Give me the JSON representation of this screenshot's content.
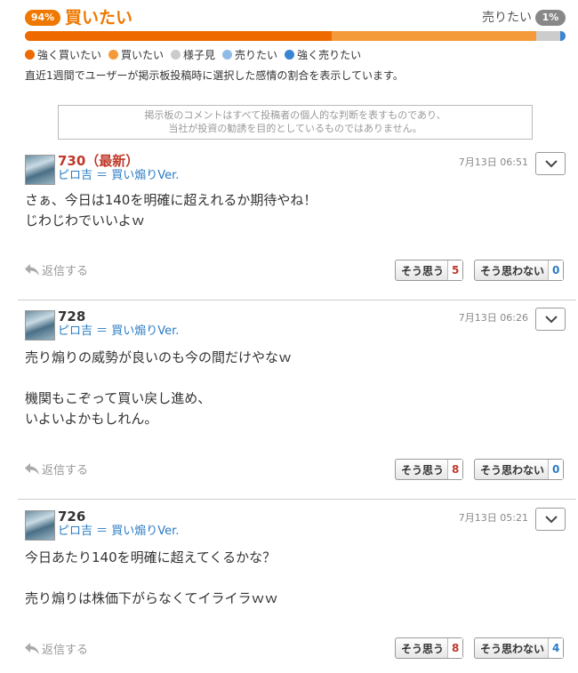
{
  "sentiment": {
    "buy_percent": "94%",
    "buy_label": "買いたい",
    "sell_label": "売りたい",
    "sell_percent": "1%",
    "bar_segments": [
      {
        "name": "strong-buy",
        "fraction": 0.57,
        "color": "#ee6a00"
      },
      {
        "name": "buy",
        "fraction": 0.38,
        "color": "#f59a3a"
      },
      {
        "name": "neutral",
        "fraction": 0.045,
        "color": "#cccccc"
      },
      {
        "name": "sell",
        "fraction": 0.0,
        "color": "#8fbce6"
      },
      {
        "name": "strong-sell",
        "fraction": 0.01,
        "color": "#3a84d4"
      }
    ],
    "legend": [
      {
        "label": "強く買いたい",
        "color": "#ee6a00"
      },
      {
        "label": "買いたい",
        "color": "#f59a3a"
      },
      {
        "label": "様子見",
        "color": "#cccccc"
      },
      {
        "label": "売りたい",
        "color": "#8fbce6"
      },
      {
        "label": "強く売りたい",
        "color": "#3a84d4"
      }
    ],
    "note": "直近1週間でユーザーが掲示板投稿時に選択した感情の割合を表示しています。"
  },
  "disclaimer": {
    "line1": "掲示板のコメントはすべて投稿者の個人的な判断を表すものであり、",
    "line2": "当社が投資の勧誘を目的としているものではありません。"
  },
  "posts": [
    {
      "number": "730（最新）",
      "author": "ピロ吉 ＝ 買い煽りVer.",
      "date": "7月13日 06:51",
      "lines": [
        "さぁ、今日は140を明確に超えれるか期待やね！",
        "じわじわでいいよｗ"
      ],
      "reply_label": "返信する",
      "agree_label": "そう思う",
      "agree_count": "5",
      "disagree_label": "そう思わない",
      "disagree_count": "0"
    },
    {
      "number": "728",
      "author": "ピロ吉 ＝ 買い煽りVer.",
      "date": "7月13日 06:26",
      "lines": [
        "売り煽りの威勢が良いのも今の間だけやなｗ",
        "",
        "機関もこぞって買い戻し進め、",
        "いよいよかもしれん。"
      ],
      "reply_label": "返信する",
      "agree_label": "そう思う",
      "agree_count": "8",
      "disagree_label": "そう思わない",
      "disagree_count": "0"
    },
    {
      "number": "726",
      "author": "ピロ吉 ＝ 買い煽りVer.",
      "date": "7月13日 05:21",
      "lines": [
        "今日あたり140を明確に超えてくるかな？",
        "",
        "売り煽りは株価下がらなくてイライラｗｗ"
      ],
      "reply_label": "返信する",
      "agree_label": "そう思う",
      "agree_count": "8",
      "disagree_label": "そう思わない",
      "disagree_count": "4"
    }
  ]
}
